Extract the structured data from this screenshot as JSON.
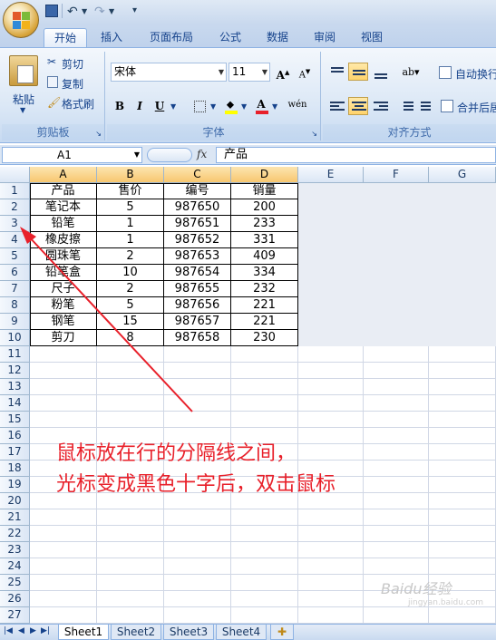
{
  "ribbon_tabs": [
    "开始",
    "插入",
    "页面布局",
    "公式",
    "数据",
    "审阅",
    "视图"
  ],
  "clipboard": {
    "paste": "粘贴",
    "cut": "剪切",
    "copy": "复制",
    "format_painter": "格式刷",
    "label": "剪贴板"
  },
  "font": {
    "name": "宋体",
    "size": "11",
    "label": "字体",
    "bold": "B",
    "italic": "I",
    "underline": "U",
    "phonetic": "wén"
  },
  "alignment": {
    "wrap_text": "自动换行",
    "merge_center": "合并后居",
    "label": "对齐方式"
  },
  "formula_bar": {
    "name_box": "A1",
    "fx": "fx",
    "content": "产品"
  },
  "columns": [
    "A",
    "B",
    "C",
    "D",
    "E",
    "F",
    "G"
  ],
  "rows": [
    "1",
    "2",
    "3",
    "4",
    "5",
    "6",
    "7",
    "8",
    "9",
    "10",
    "11",
    "12",
    "13",
    "14",
    "15",
    "16",
    "17",
    "18",
    "19",
    "20",
    "21",
    "22",
    "23",
    "24",
    "25",
    "26",
    "27"
  ],
  "table": [
    [
      "产品",
      "售价",
      "编号",
      "销量"
    ],
    [
      "笔记本",
      "5",
      "987650",
      "200"
    ],
    [
      "铅笔",
      "1",
      "987651",
      "233"
    ],
    [
      "橡皮擦",
      "1",
      "987652",
      "331"
    ],
    [
      "圆珠笔",
      "2",
      "987653",
      "409"
    ],
    [
      "铅笔盒",
      "10",
      "987654",
      "334"
    ],
    [
      "尺子",
      "2",
      "987655",
      "232"
    ],
    [
      "粉笔",
      "5",
      "987656",
      "221"
    ],
    [
      "钢笔",
      "15",
      "987657",
      "221"
    ],
    [
      "剪刀",
      "8",
      "987658",
      "230"
    ]
  ],
  "annotation": {
    "line1": "鼠标放在行的分隔线之间，",
    "line2": "光标变成黑色十字后，双击鼠标"
  },
  "sheets": [
    "Sheet1",
    "Sheet2",
    "Sheet3",
    "Sheet4"
  ],
  "watermark": {
    "brand": "Baidu经验",
    "url": "jingyan.baidu.com"
  },
  "colors": {
    "annotation_red": "#e8202a",
    "ribbon_blue": "#15428b"
  }
}
